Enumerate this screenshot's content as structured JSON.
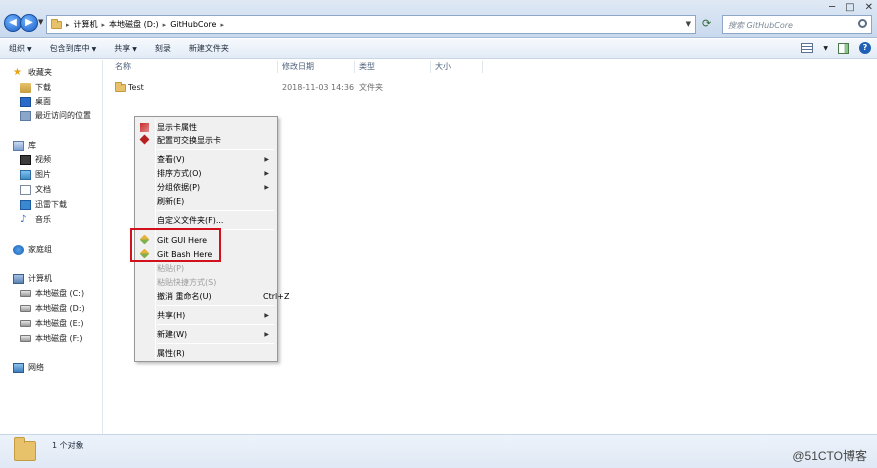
{
  "address": {
    "crumbs": [
      "计算机",
      "本地磁盘 (D:)",
      "GitHubCore"
    ],
    "search_placeholder": "搜索 GitHubCore"
  },
  "toolbar": {
    "organize": "组织",
    "include_library": "包含到库中",
    "share": "共享",
    "burn": "刻录",
    "new_folder": "新建文件夹"
  },
  "sidebar": {
    "favorites": "收藏夹",
    "downloads": "下载",
    "desktop": "桌面",
    "recent": "最近访问的位置",
    "libraries": "库",
    "videos": "视频",
    "pictures": "图片",
    "documents": "文档",
    "xunlei": "迅雷下载",
    "music": "音乐",
    "homegroup": "家庭组",
    "computer": "计算机",
    "drive_c": "本地磁盘 (C:)",
    "drive_d": "本地磁盘 (D:)",
    "drive_e": "本地磁盘 (E:)",
    "drive_f": "本地磁盘 (F:)",
    "network": "网络"
  },
  "columns": {
    "name": "名称",
    "date": "修改日期",
    "type": "类型",
    "size": "大小"
  },
  "files": [
    {
      "name": "Test",
      "date": "2018-11-03 14:36",
      "type": "文件夹"
    }
  ],
  "context_menu": {
    "display_props": "显示卡属性",
    "switchable_gpu": "配置可交换显示卡",
    "view": "查看(V)",
    "sort": "排序方式(O)",
    "group": "分组依据(P)",
    "refresh": "刷新(E)",
    "customize": "自定义文件夹(F)...",
    "git_gui": "Git GUI Here",
    "git_bash": "Git Bash Here",
    "paste": "粘贴(P)",
    "paste_shortcut": "粘贴快捷方式(S)",
    "undo_rename": "撤消 重命名(U)",
    "undo_shortcut": "Ctrl+Z",
    "share": "共享(H)",
    "new": "新建(W)",
    "properties": "属性(R)"
  },
  "status": {
    "count": "1 个对象",
    "watermark": "@51CTO博客"
  }
}
